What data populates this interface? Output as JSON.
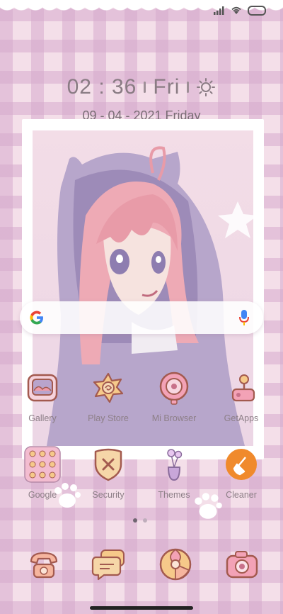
{
  "status_bar": {
    "signal_icon": "signal-icon",
    "wifi_icon": "wifi-icon",
    "battery_icon": "battery-icon"
  },
  "clock": {
    "time": "02 : 36",
    "weekday": "Fri",
    "weather_icon": "sun-icon"
  },
  "date": {
    "text": "09 - 04 - 2021 Friday"
  },
  "search_bar": {
    "logo": "google-g-icon",
    "mic": "mic-icon"
  },
  "apps_row1": [
    {
      "label": "Gallery",
      "icon": "gallery-icon"
    },
    {
      "label": "Play Store",
      "icon": "play-store-icon"
    },
    {
      "label": "Mi Browser",
      "icon": "mi-browser-icon"
    },
    {
      "label": "GetApps",
      "icon": "getapps-icon"
    }
  ],
  "apps_row2": [
    {
      "label": "Google",
      "icon": "google-folder-icon"
    },
    {
      "label": "Security",
      "icon": "security-icon"
    },
    {
      "label": "Themes",
      "icon": "themes-icon"
    },
    {
      "label": "Cleaner",
      "icon": "cleaner-icon"
    }
  ],
  "page_indicator": {
    "pages": 2,
    "current": 1
  },
  "dock": [
    {
      "icon": "phone-icon"
    },
    {
      "icon": "messages-icon"
    },
    {
      "icon": "browser-icon"
    },
    {
      "icon": "camera-icon"
    }
  ],
  "colors": {
    "accent": "#f0919e",
    "cleaner": "#f08a2c",
    "icon_outline": "#a35a4f"
  }
}
